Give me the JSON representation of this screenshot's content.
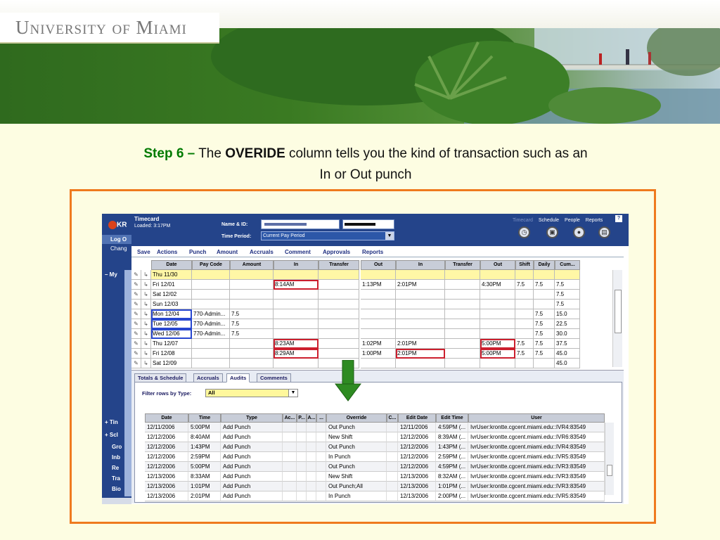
{
  "banner": {
    "logo_text": "University of Miami"
  },
  "heading": {
    "step": "Step 6 –",
    "pre": "The",
    "keyword": "OVERIDE",
    "rest": "column tells you the kind of transaction such as an",
    "line2": "In or Out punch"
  },
  "app": {
    "nav": {
      "logo": "KR",
      "items": [
        "Log O",
        "Chang",
        "–  My",
        "+  Tin",
        "+  Scl",
        "Gro",
        "Inb",
        "Re",
        "Tra",
        "Bio"
      ]
    },
    "title": "Timecard",
    "loaded": "Loaded: 3:17PM",
    "name_label": "Name & ID:",
    "period_label": "Time Period:",
    "period_value": "Current Pay Period",
    "top_links": [
      "Timecard",
      "Schedule",
      "People",
      "Reports"
    ],
    "help": "?",
    "toolbar": [
      "Save",
      "Actions",
      "Punch",
      "Amount",
      "Accruals",
      "Comment",
      "Approvals",
      "Reports"
    ],
    "grid": {
      "headers": [
        "Date",
        "Pay Code",
        "Amount",
        "In",
        "Transfer",
        "Out",
        "In",
        "Transfer",
        "Out",
        "Shift",
        "Daily",
        "Cum..."
      ],
      "rows": [
        {
          "date": "Thu 11/30",
          "pay": "",
          "amount": "",
          "in1": "",
          "out1": "",
          "in2": "",
          "out2": "",
          "shift": "",
          "daily": "",
          "cum": ""
        },
        {
          "date": "Fri 12/01",
          "pay": "",
          "amount": "",
          "in1": "8:14AM",
          "out1": "1:13PM",
          "in2": "2:01PM",
          "out2": "4:30PM",
          "shift": "7.5",
          "daily": "7.5",
          "cum": "7.5"
        },
        {
          "date": "Sat 12/02",
          "pay": "",
          "amount": "",
          "in1": "",
          "out1": "",
          "in2": "",
          "out2": "",
          "shift": "",
          "daily": "",
          "cum": "7.5"
        },
        {
          "date": "Sun 12/03",
          "pay": "",
          "amount": "",
          "in1": "",
          "out1": "",
          "in2": "",
          "out2": "",
          "shift": "",
          "daily": "",
          "cum": "7.5"
        },
        {
          "date": "Mon 12/04",
          "pay": "770-Admin...",
          "amount": "7.5",
          "in1": "",
          "out1": "",
          "in2": "",
          "out2": "",
          "shift": "",
          "daily": "7.5",
          "cum": "15.0"
        },
        {
          "date": "Tue 12/05",
          "pay": "770-Admin...",
          "amount": "7.5",
          "in1": "",
          "out1": "",
          "in2": "",
          "out2": "",
          "shift": "",
          "daily": "7.5",
          "cum": "22.5"
        },
        {
          "date": "Wed 12/06",
          "pay": "770-Admin...",
          "amount": "7.5",
          "in1": "",
          "out1": "",
          "in2": "",
          "out2": "",
          "shift": "",
          "daily": "7.5",
          "cum": "30.0"
        },
        {
          "date": "Thu 12/07",
          "pay": "",
          "amount": "",
          "in1": "8:23AM",
          "out1": "1:02PM",
          "in2": "2:01PM",
          "out2": "5:00PM",
          "shift": "7.5",
          "daily": "7.5",
          "cum": "37.5"
        },
        {
          "date": "Fri 12/08",
          "pay": "",
          "amount": "",
          "in1": "8:29AM",
          "out1": "1:00PM",
          "in2": "2:01PM",
          "out2": "5:00PM",
          "shift": "7.5",
          "daily": "7.5",
          "cum": "45.0"
        },
        {
          "date": "Sat 12/09",
          "pay": "",
          "amount": "",
          "in1": "",
          "out1": "",
          "in2": "",
          "out2": "",
          "shift": "",
          "daily": "",
          "cum": "45.0"
        }
      ]
    },
    "tabs": [
      "Totals & Schedule",
      "Accruals",
      "Audits",
      "Comments"
    ],
    "filter_label": "Filter rows by Type:",
    "filter_value": "All",
    "audit": {
      "headers": [
        "Date",
        "Time",
        "Type",
        "Ac...",
        "P...",
        "A...",
        "...",
        "Override",
        "C...",
        "Edit Date",
        "Edit Time",
        "User"
      ],
      "rows": [
        [
          "12/11/2006",
          "5:00PM",
          "Add Punch",
          "Out Punch",
          "12/11/2006",
          "4:59PM (...",
          "IvrUser:krontte.cgcent.miami.edu::IVR4:83549"
        ],
        [
          "12/12/2006",
          "8:40AM",
          "Add Punch",
          "New Shift",
          "12/12/2006",
          "8:39AM (...",
          "IvrUser:krontte.cgcent.miami.edu::IVR6:83549"
        ],
        [
          "12/12/2006",
          "1:43PM",
          "Add Punch",
          "Out Punch",
          "12/12/2006",
          "1:43PM (...",
          "IvrUser:krontte.cgcent.miami.edu::IVR4:83549"
        ],
        [
          "12/12/2006",
          "2:59PM",
          "Add Punch",
          "In Punch",
          "12/12/2006",
          "2:59PM (...",
          "IvrUser:krontte.cgcent.miami.edu::IVR5:83549"
        ],
        [
          "12/12/2006",
          "5:00PM",
          "Add Punch",
          "Out Punch",
          "12/12/2006",
          "4:59PM (...",
          "IvrUser:krontte.cgcent.miami.edu::IVR3:83549"
        ],
        [
          "12/13/2006",
          "8:33AM",
          "Add Punch",
          "New Shift",
          "12/13/2006",
          "8:32AM (...",
          "IvrUser:krontte.cgcent.miami.edu::IVR3:83549"
        ],
        [
          "12/13/2006",
          "1:01PM",
          "Add Punch",
          "Out Punch;All",
          "12/13/2006",
          "1:01PM (...",
          "IvrUser:krontte.cgcent.miami.edu::IVR3:83549"
        ],
        [
          "12/13/2006",
          "2:01PM",
          "Add Punch",
          "In Punch",
          "12/13/2006",
          "2:00PM (...",
          "IvrUser:krontte.cgcent.miami.edu::IVR5:83549"
        ]
      ]
    }
  },
  "colors": {
    "step": "#007a00",
    "frame": "#ef7a1e",
    "kronos_blue": "#24448a",
    "highlight_red": "#cc1f2e",
    "highlight_blue": "#2847d0",
    "arrow_green": "#2e8b22"
  },
  "icons": [
    "clock-icon",
    "schedule-icon",
    "people-icon",
    "reports-icon",
    "edit-icon",
    "transfer-icon",
    "green-down-arrow"
  ]
}
